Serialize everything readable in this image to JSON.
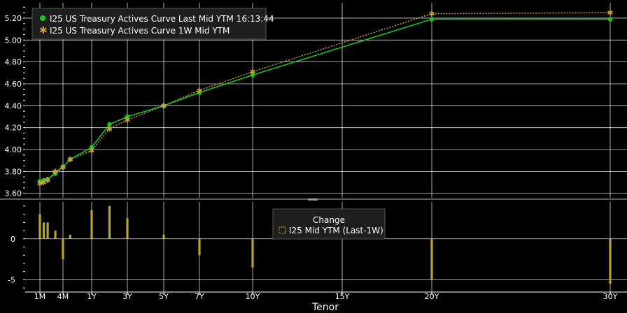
{
  "colors": {
    "background": "#000000",
    "grid": "#ffffff",
    "axis_text": "#ffffff",
    "last_series": "#1ec21e",
    "week_series": "#c8a040",
    "change_bars": "#b8a52a",
    "legend_bg": "#1e1e1e",
    "legend_border": "#555555"
  },
  "chart_data": [
    {
      "type": "line",
      "x_labels": [
        "1M",
        "4M",
        "1Y",
        "3Y",
        "5Y",
        "7Y",
        "10Y",
        "15Y",
        "20Y",
        "30Y"
      ],
      "x": [
        "1M",
        "2M",
        "3M",
        "4M",
        "6M",
        "1Y",
        "2Y",
        "3Y",
        "5Y",
        "7Y",
        "10Y",
        "20Y",
        "30Y"
      ],
      "x_years": [
        0.083,
        0.167,
        0.25,
        0.333,
        0.5,
        1,
        2,
        3,
        5,
        7,
        10,
        20,
        30
      ],
      "series": [
        {
          "name": "I25 US Treasury Actives Curve Last Mid YTM 16:13:44",
          "marker": "dot",
          "values": [
            3.71,
            3.72,
            3.73,
            3.78,
            3.84,
            3.91,
            4.02,
            4.23,
            4.3,
            4.4,
            4.52,
            4.68,
            5.19,
            5.19
          ]
        },
        {
          "name": "I25 US Treasury Actives Curve 1W Mid YTM",
          "marker": "star",
          "values": [
            3.69,
            3.7,
            3.72,
            3.8,
            3.84,
            3.91,
            3.99,
            4.19,
            4.27,
            4.4,
            4.54,
            4.71,
            5.24,
            5.25
          ]
        }
      ],
      "y_ticks": [
        "3.60",
        "3.80",
        "4.00",
        "4.20",
        "4.40",
        "4.60",
        "4.80",
        "5.00",
        "5.20"
      ],
      "ylim": [
        3.56,
        5.34
      ],
      "grid": true,
      "legend_position": "top-left"
    },
    {
      "type": "bar",
      "title": "Change",
      "legend_entry": "I25 Mid YTM (Last-1W)",
      "categories": [
        "1M",
        "1.5M",
        "2M",
        "3M",
        "4M",
        "6M",
        "1Y",
        "2Y",
        "3Y",
        "5Y",
        "7Y",
        "10Y",
        "20Y",
        "30Y"
      ],
      "x_years": [
        0.083,
        0.125,
        0.167,
        0.25,
        0.333,
        0.5,
        1,
        2,
        3,
        5,
        7,
        10,
        20,
        30
      ],
      "values": [
        3,
        2,
        2,
        1,
        -2.5,
        0.5,
        3.5,
        4,
        2.5,
        0.5,
        -2,
        -3.5,
        -5,
        -5.5
      ],
      "y_ticks": [
        "-5",
        "0"
      ],
      "ylim": [
        -6.5,
        4.5
      ],
      "grid": true,
      "legend_position": "center-right"
    }
  ],
  "xlabel": "Tenor"
}
